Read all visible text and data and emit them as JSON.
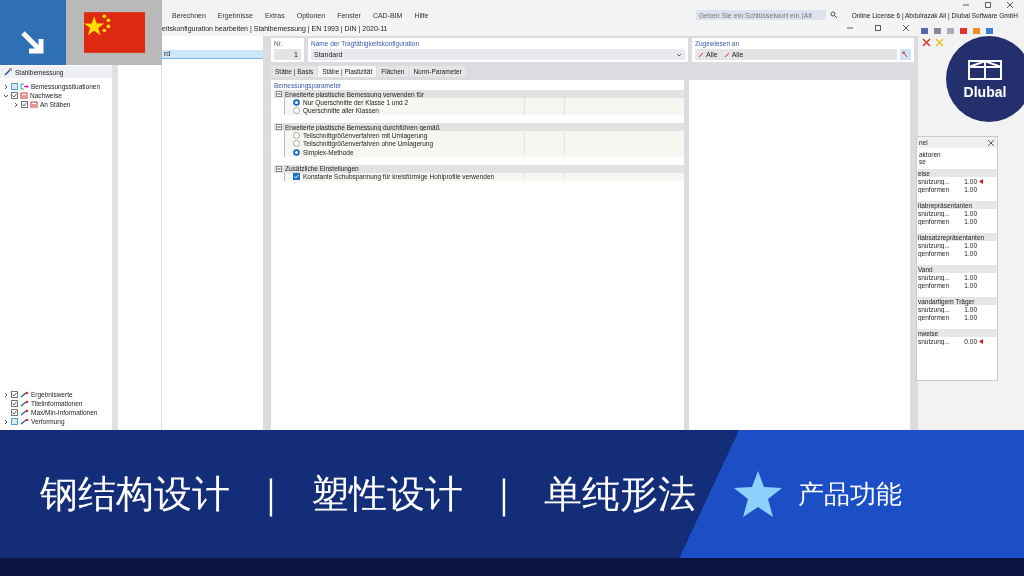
{
  "menu": [
    "Berechnen",
    "Ergebnisse",
    "Extras",
    "Optionen",
    "Fenster",
    "CAD-BIM",
    "Hilfe"
  ],
  "search": {
    "placeholder": "Geben Sie ein Schlüsselwort ein (Alt"
  },
  "license": "Online License 6 | Abdulrazak Ali | Dlubal Software GmbH",
  "navigator": {
    "title": "Stahlbemessung",
    "items": [
      {
        "label": "Bemessungssituationen",
        "kind": "situation",
        "checked": false,
        "expanded": false
      },
      {
        "label": "Nachweise",
        "kind": "check",
        "checked": true,
        "expanded": true,
        "children": [
          {
            "label": "An Stäben",
            "kind": "check",
            "checked": true,
            "expanded": false
          }
        ]
      }
    ],
    "bottom_items": [
      {
        "label": "Ergebniswerte",
        "kind": "output",
        "checked": true,
        "expanded": false
      },
      {
        "label": "Titelinformationen",
        "kind": "output",
        "checked": true
      },
      {
        "label": "Max/Min-Informationen",
        "kind": "output",
        "checked": true
      },
      {
        "label": "Verformung",
        "kind": "output",
        "checked": false,
        "expanded": false
      }
    ]
  },
  "dialog": {
    "title": "eitskonfiguration bearbeiten | Stahlbemessung | EN 1993 | DIN | 2020-11",
    "list": [
      {
        "label": "rd",
        "selected": true
      }
    ],
    "nr": {
      "label": "Nr.",
      "value": "1"
    },
    "name": {
      "label": "Name der Tragfähigkeitskonfiguration",
      "value": "Standard"
    },
    "assigned": {
      "label": "Zugewiesen an",
      "values": [
        "Alle",
        "Alle"
      ]
    },
    "tabs": [
      {
        "label": "Stäbe | Basis",
        "selected": false
      },
      {
        "label": "Stäbe | Plastizität",
        "selected": true
      },
      {
        "label": "Flächen",
        "selected": false
      },
      {
        "label": "Norm-Parameter",
        "selected": false
      }
    ],
    "section_title": "Bemessungsparameter",
    "groups": [
      {
        "title": "Erweiterte plastische Bemessung verwenden für",
        "options": [
          {
            "kind": "radio",
            "label": "Nur Querschnitte der Klasse 1 und 2",
            "selected": true
          },
          {
            "kind": "radio",
            "label": "Querschnitte aller Klassen",
            "selected": false
          }
        ]
      },
      {
        "title": "Erweiterte plastische Bemessung durchführen gemäß",
        "options": [
          {
            "kind": "radio",
            "label": "Teilschnittgrößenverfahren mit Umlagerung",
            "selected": false
          },
          {
            "kind": "radio",
            "label": "Teilschnittgrößenverfahren ohne Umlagerung",
            "selected": false
          },
          {
            "kind": "radio",
            "label": "Simplex-Methode",
            "selected": true
          }
        ]
      },
      {
        "title": "Zusätzliche Einstellungen",
        "options": [
          {
            "kind": "checkbox",
            "label": "Konstante Schubspannung für kreisförmige Hohlprofile verwenden",
            "checked": true
          }
        ]
      }
    ]
  },
  "panel": {
    "title": "nel",
    "lines": [
      "aktoren",
      "se"
    ],
    "sections": [
      {
        "title": "eise",
        "rows": [
          {
            "label": "snutzung...",
            "value": "1.00",
            "flag": true
          },
          {
            "label": "genformen",
            "value": "1.00",
            "flag": false
          }
        ]
      },
      {
        "title": "itabrepräsentanten",
        "rows": [
          {
            "label": "snutzung...",
            "value": "1.00",
            "flag": false
          },
          {
            "label": "genformen",
            "value": "1.00",
            "flag": false
          }
        ]
      },
      {
        "title": "itabsatzrepräsentanten",
        "rows": [
          {
            "label": "snutzung...",
            "value": "1.00",
            "flag": false
          },
          {
            "label": "genformen",
            "value": "1.00",
            "flag": false
          }
        ]
      },
      {
        "title": "Vand",
        "rows": [
          {
            "label": "snutzung...",
            "value": "1.00",
            "flag": false
          },
          {
            "label": "genformen",
            "value": "1.00",
            "flag": false
          }
        ]
      },
      {
        "title": "vandartigem Träger",
        "rows": [
          {
            "label": "snutzung...",
            "value": "1.00",
            "flag": false
          },
          {
            "label": "genformen",
            "value": "1.00",
            "flag": false
          }
        ]
      },
      {
        "title": "nweise",
        "rows": [
          {
            "label": "snutzung...",
            "value": "0.00",
            "flag": true
          }
        ]
      }
    ]
  },
  "logo": {
    "text": "Dlubal"
  },
  "banner": {
    "parts": [
      "钢结构设计",
      "｜",
      "塑性设计",
      "｜",
      "单纯形法"
    ],
    "tag": "产品功能"
  }
}
